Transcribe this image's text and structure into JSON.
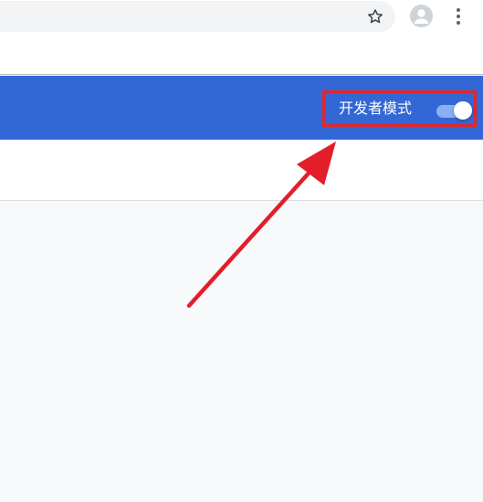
{
  "toolbar": {
    "icons": {
      "bookmark": "star-outline-icon",
      "profile": "account-avatar-icon",
      "menu": "kebab-menu-icon"
    }
  },
  "extensions_header": {
    "dev_mode_label": "开发者模式",
    "dev_mode_enabled": true
  },
  "colors": {
    "header_blue": "#3367d6",
    "highlight_red": "#e0262c",
    "toggle_track": "#8ab0f3",
    "content_bg": "#f8f9fa"
  }
}
